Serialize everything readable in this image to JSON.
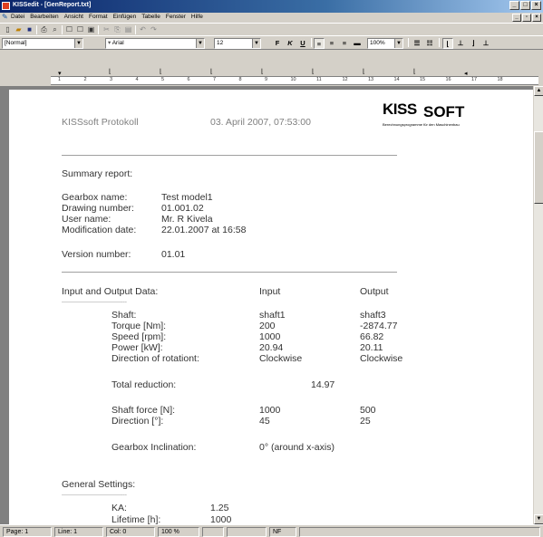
{
  "window": {
    "title": "KISSedit - [GenReport.txt]"
  },
  "menu": [
    "Datei",
    "Bearbeiten",
    "Ansicht",
    "Format",
    "Einfügen",
    "Tabelle",
    "Fenster",
    "Hilfe"
  ],
  "format_bar": {
    "style": "[Normal]",
    "font": "Arial",
    "size": "12",
    "zoom": "100%",
    "bold": "F",
    "italic": "K",
    "underline": "U"
  },
  "ruler": {
    "numbers": [
      "1",
      "2",
      "3",
      "4",
      "5",
      "6",
      "7",
      "8",
      "9",
      "10",
      "11",
      "12",
      "13",
      "14",
      "15",
      "16",
      "17",
      "18"
    ]
  },
  "document": {
    "header_left": "KISSsoft Protokoll",
    "header_date": "03. April 2007, 07:53:00",
    "logo_kiss": "KISS",
    "logo_soft": "SOFT",
    "logo_sub": "Berechnungsprogramme für den Maschinenbau",
    "summary_title": "Summary report:",
    "info": [
      {
        "label": "Gearbox name:",
        "value": "Test model1"
      },
      {
        "label": "Drawing number:",
        "value": "01.001.02"
      },
      {
        "label": "User name:",
        "value": "Mr. R Kivela"
      },
      {
        "label": "Modification date:",
        "value": "22.01.2007 at 16:58"
      }
    ],
    "version_label": "Version number:",
    "version_value": "01.01",
    "io_title": "Input and Output Data:",
    "io_col_input": "Input",
    "io_col_output": "Output",
    "dashes": "------------------------------------",
    "io_rows": [
      {
        "label": "Shaft:",
        "input": "shaft1",
        "output": "shaft3"
      },
      {
        "label": "Torque [Nm]:",
        "input": "200",
        "output": "-2874.77"
      },
      {
        "label": "Speed [rpm]:",
        "input": "1000",
        "output": "66.82"
      },
      {
        "label": "Power [kW]:",
        "input": "20.94",
        "output": "20.11"
      },
      {
        "label": "Direction of rotationt:",
        "input": "Clockwise",
        "output": "Clockwise"
      }
    ],
    "total_reduction_label": "Total reduction:",
    "total_reduction_value": "14.97",
    "force_rows": [
      {
        "label": "Shaft force [N]:",
        "input": "1000",
        "output": "500"
      },
      {
        "label": "Direction [°]:",
        "input": "45",
        "output": "25"
      }
    ],
    "inclination_label": "Gearbox Inclination:",
    "inclination_value": "0° (around x-axis)",
    "general_title": "General Settings:",
    "ka_label": "KA:",
    "ka_value": "1.25",
    "lifetime_label": "Lifetime [h]:",
    "lifetime_value": "1000"
  },
  "status": {
    "page": "Page:  1",
    "line": "Line:  1",
    "col": "Col:  0",
    "zoom": "100 %",
    "nf": "NF"
  }
}
